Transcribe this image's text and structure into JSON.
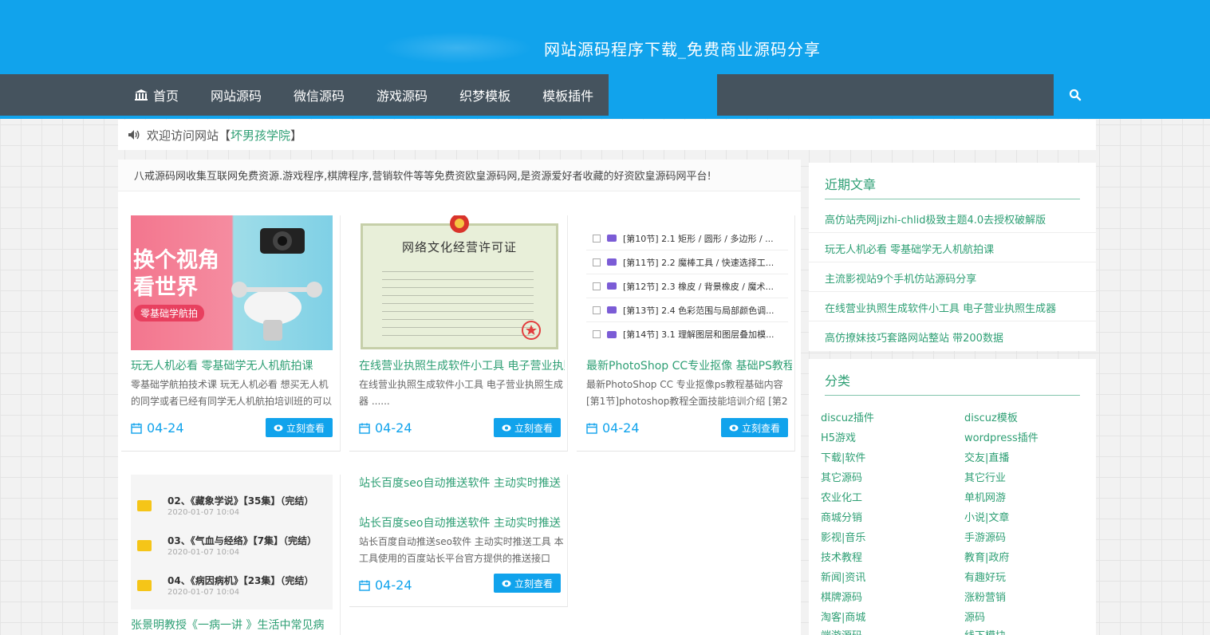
{
  "header": {
    "site_title": "网站源码程序下载_免费商业源码分享"
  },
  "nav": {
    "items": [
      {
        "label": "首页"
      },
      {
        "label": "网站源码"
      },
      {
        "label": "微信源码"
      },
      {
        "label": "游戏源码"
      },
      {
        "label": "织梦模板"
      },
      {
        "label": "模板插件"
      }
    ]
  },
  "notice": {
    "prefix": "欢迎访问网站",
    "open": "【",
    "site_name": "坏男孩学院",
    "close": "】"
  },
  "intro": "八戒源码网收集互联网免费资源.游戏程序,棋牌程序,营销软件等等免费资欧皇源码网,是资源爱好者收藏的好资欧皇源码网平台!",
  "cards": [
    {
      "title": "玩无人机必看 零基础学无人机航拍课",
      "desc": "零基础学航拍技术课 玩无人机必看 想买无人机的同学或者已经有同学无人机航拍培训班的可以",
      "date": "04-24",
      "btn": "立刻查看",
      "thumb_text1": "换个视角",
      "thumb_text2": "看世界",
      "thumb_badge": "零基础学航拍"
    },
    {
      "title": "在线营业执照生成软件小工具 电子营业执照生成器",
      "desc": "在线营业执照生成软件小工具 电子营业执照生成器 ......",
      "date": "04-24",
      "btn": "立刻查看",
      "thumb_text1": "网络文化经营许可证"
    },
    {
      "title": "最新PhotoShop CC专业抠像 基础PS教程",
      "desc": "最新PhotoShop CC 专业抠像ps教程基础内容 [第1节]photoshop教程全面技能培训介绍 [第2",
      "date": "04-24",
      "btn": "立刻查看",
      "lessons": [
        "[第10节] 2.1 矩形 / 圆形 / 多边形 / ...",
        "[第11节] 2.2 魔棒工具 / 快速选择工...",
        "[第12节] 2.3 橡皮 / 背景橡皮 / 魔术...",
        "[第13节] 2.4 色彩范围与局部颜色调...",
        "[第14节] 3.1 理解图层和图层叠加模..."
      ]
    },
    {
      "title": "张景明教授《一病一讲 》生活中常见病",
      "episodes": [
        {
          "name": "02、《藏象学说》【35集】（完结）",
          "date": "2020-01-07  10:04"
        },
        {
          "name": "03、《气血与经络》【7集】（完结）",
          "date": "2020-01-07  10:04"
        },
        {
          "name": "04、《病因病机》【23集】（完结）",
          "date": "2020-01-07  10:04"
        }
      ]
    },
    {
      "title": "站长百度seo自动推送软件 主动实时推送",
      "img_alt": "站长百度seo自动推送软件 主动实时推送",
      "desc": "站长百度自动推送seo软件 主动实时推送工具 本工具使用的百度站长平台官方提供的推送接口",
      "date": "04-24",
      "btn": "立刻查看"
    }
  ],
  "sidebar": {
    "recent_title": "近期文章",
    "recent": [
      "高仿站壳网jizhi-chlid极致主题4.0去授权破解版",
      "玩无人机必看 零基础学无人机航拍课",
      "主流影视站9个手机仿站源码分享",
      "在线营业执照生成软件小工具 电子营业执照生成器",
      "高仿撩妹技巧套路网站整站 带200数据"
    ],
    "cat_title": "分类",
    "categories": [
      "discuz插件",
      "discuz模板",
      "H5游戏",
      "wordpress插件",
      "下载|软件",
      "交友|直播",
      "其它源码",
      "其它行业",
      "农业化工",
      "单机网游",
      "商城分销",
      "小说|文章",
      "影视|音乐",
      "手游源码",
      "技术教程",
      "教育|政府",
      "新闻|资讯",
      "有趣好玩",
      "棋牌源码",
      "涨粉营销",
      "淘客|商城",
      "源码",
      "端游源码",
      "线下模块"
    ]
  }
}
